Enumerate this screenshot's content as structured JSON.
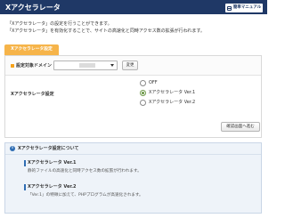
{
  "header": {
    "title": "Xアクセラレータ",
    "manual_label": "簡単マニュアル"
  },
  "intro": {
    "line1": "「Xアクセラレータ」の設定を行うことができます。",
    "line2": "「Xアクセラレータ」を有効化することで、サイトの高速化と同時アクセス数の拡張が行われます。"
  },
  "tab": {
    "label": "Xアクセラレータ設定"
  },
  "domain": {
    "label": "設定対象ドメイン",
    "change_label": "変更"
  },
  "setting": {
    "label": "Xアクセラレータ設定",
    "options": [
      {
        "label": "OFF",
        "selected": false
      },
      {
        "label": "Xアクセラレータ Ver.1",
        "selected": true
      },
      {
        "label": "Xアクセラレータ Ver.2",
        "selected": false
      }
    ],
    "confirm_label": "確認画面へ進む"
  },
  "info": {
    "icon_glyph": "i",
    "title": "Xアクセラレータ設定について",
    "items": [
      {
        "heading": "Xアクセラレータ Ver.1",
        "desc": "静的ファイルの高速化と同時アクセス数の拡張が行われます。"
      },
      {
        "heading": "Xアクセラレータ Ver.2",
        "desc": "「Ver.1」の特徴に加えて、PHPプログラムが高速化されます。"
      }
    ]
  },
  "colors": {
    "header_bg": "#1f3866",
    "tab_bg": "#f6b44a",
    "radio_selected": "#6f9a4a",
    "info_accent": "#2f6db3",
    "info_bg": "#eef3f9"
  }
}
